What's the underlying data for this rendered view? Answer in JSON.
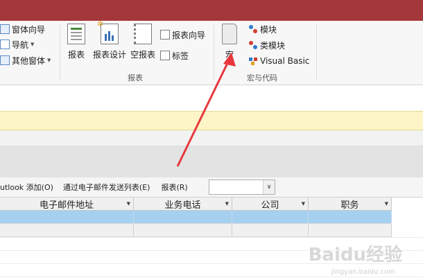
{
  "ribbon": {
    "forms_group": {
      "form_wizard": "窗体向导",
      "navigation": "导航",
      "more_forms": "其他窗体"
    },
    "reports_group": {
      "label": "报表",
      "report": "报表",
      "report_design": "报表设计",
      "blank_report": "空报表",
      "report_wizard": "报表向导",
      "labels": "标签"
    },
    "macros_group": {
      "label": "宏与代码",
      "macro": "宏",
      "module": "模块",
      "class_module": "类模块",
      "visual_basic": "Visual Basic"
    }
  },
  "toolbar": {
    "outlook_add": "utlook 添加(O)",
    "send_email_list": "通过电子邮件发送列表(E)",
    "report_label": "报表(R)",
    "report_combo_value": ""
  },
  "table": {
    "columns": [
      "电子邮件地址",
      "业务电话",
      "公司",
      "职务"
    ]
  },
  "watermark": {
    "brand": "Baidu经验",
    "url": "jingyan.baidu.com"
  },
  "colors": {
    "title_bar": "#a4373a",
    "selected_row": "#a6d0f0",
    "message_bar": "#fdf5c7",
    "arrow": "#e8383d"
  }
}
